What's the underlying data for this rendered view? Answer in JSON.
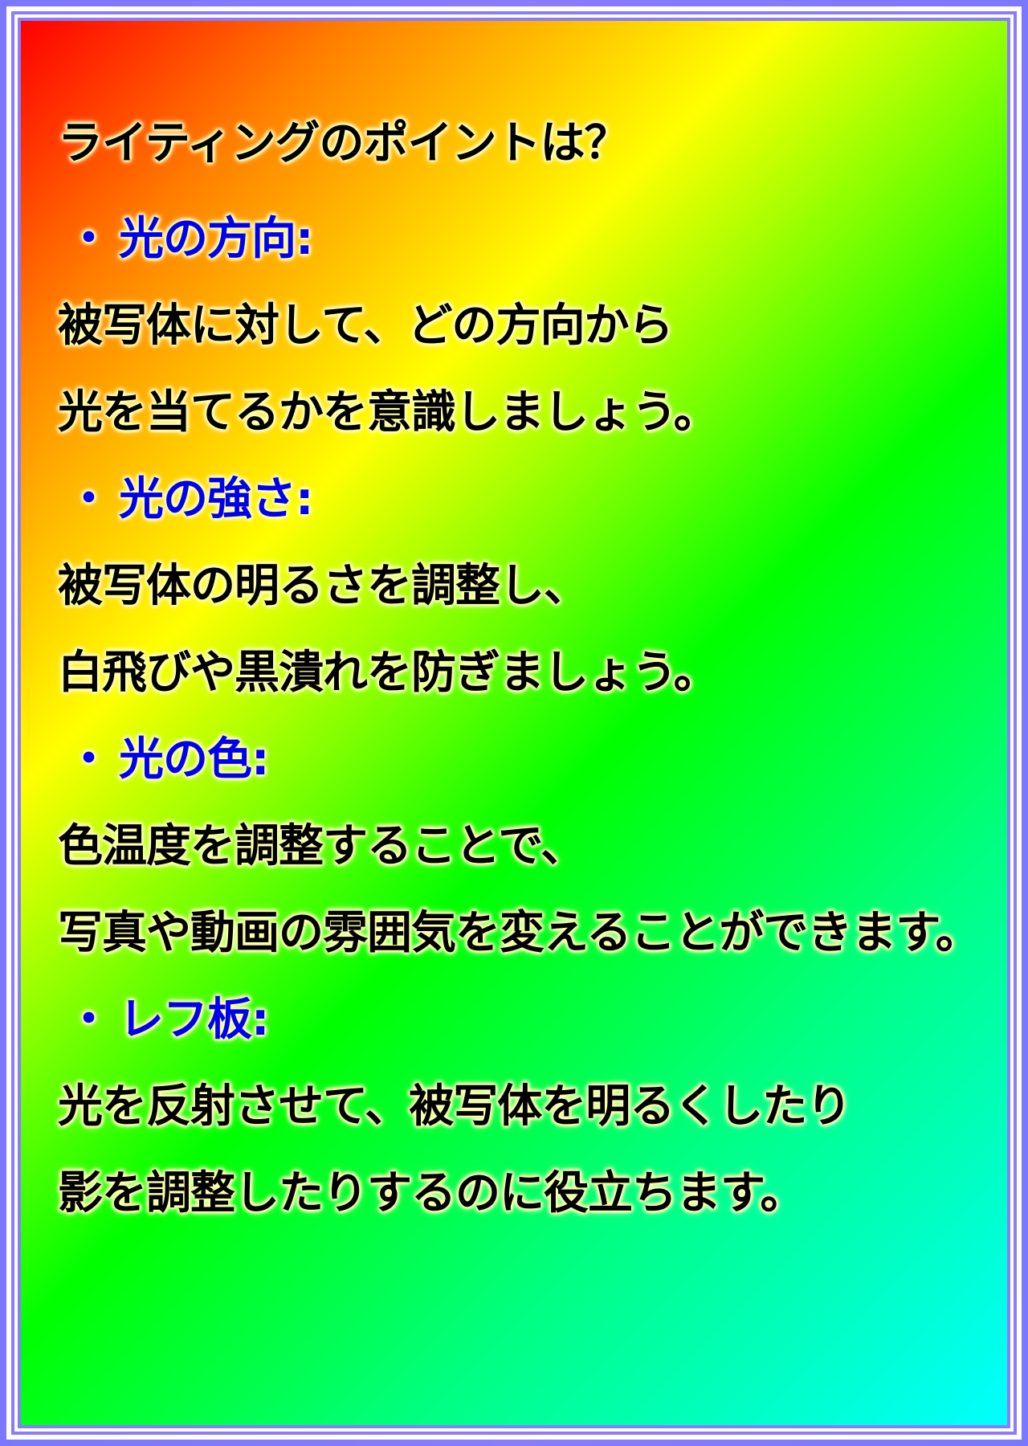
{
  "title": "ライティングのポイントは？",
  "sections": [
    {
      "bullet": "・",
      "heading": "光の方向:",
      "lines": [
        "被写体に対して、どの方向から",
        "光を当てるかを意識しましょう。"
      ]
    },
    {
      "bullet": "・",
      "heading": "光の強さ:",
      "lines": [
        "被写体の明るさを調整し、",
        "白飛びや黒潰れを防ぎましょう。"
      ]
    },
    {
      "bullet": "・",
      "heading": "光の色:",
      "lines": [
        "色温度を調整することで、",
        "写真や動画の雰囲気を変えることができます。"
      ]
    },
    {
      "bullet": "・",
      "heading": "レフ板:",
      "lines": [
        "光を反射させて、被写体を明るくしたり",
        "影を調整したりするのに役立ちます。"
      ]
    }
  ],
  "colors": {
    "frame": "#8a7cff",
    "heading": "#0000ee",
    "body_text": "#000000",
    "glow": "#ffffaa"
  }
}
